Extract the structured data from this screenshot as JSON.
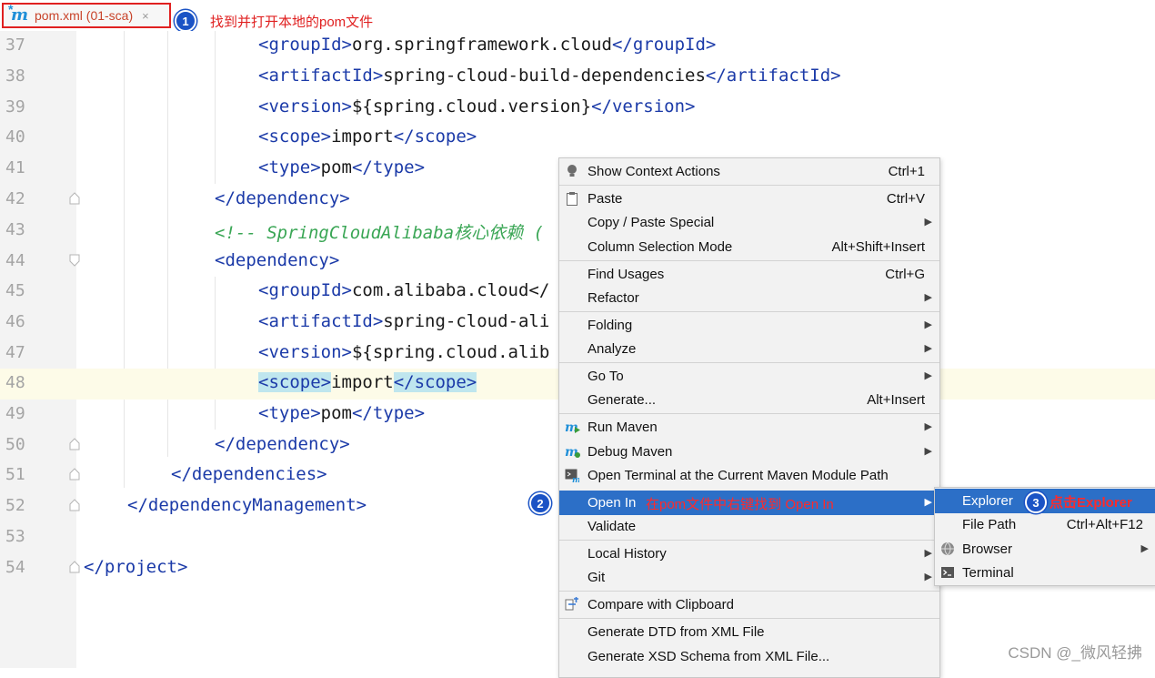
{
  "tab": {
    "title": "pom.xml (01-sca)",
    "close": "×"
  },
  "annotations": {
    "one": "1",
    "note1": "找到并打开本地的pom文件",
    "two": "2",
    "note2": "在pom文件中右键找到 Open In",
    "three": "3",
    "note3": "点击Explorer"
  },
  "editor": {
    "lines": [
      {
        "num": "37"
      },
      {
        "num": "38"
      },
      {
        "num": "39"
      },
      {
        "num": "40"
      },
      {
        "num": "41"
      },
      {
        "num": "42"
      },
      {
        "num": "43"
      },
      {
        "num": "44"
      },
      {
        "num": "45"
      },
      {
        "num": "46"
      },
      {
        "num": "47"
      },
      {
        "num": "48"
      },
      {
        "num": "49"
      },
      {
        "num": "50"
      },
      {
        "num": "51"
      },
      {
        "num": "52"
      },
      {
        "num": "53"
      },
      {
        "num": "54"
      }
    ],
    "code": {
      "l37": {
        "o": "<groupId>",
        "t": "org.springframework.cloud",
        "c": "</groupId>"
      },
      "l38": {
        "o": "<artifactId>",
        "t": "spring-cloud-build-dependencies",
        "c": "</artifactId>"
      },
      "l39": {
        "o": "<version>",
        "t": "${spring.cloud.version}",
        "c": "</version>"
      },
      "l40": {
        "o": "<scope>",
        "t": "import",
        "c": "</scope>"
      },
      "l41": {
        "o": "<type>",
        "t": "pom",
        "c": "</type>"
      },
      "l42": {
        "c": "</dependency>"
      },
      "l43": {
        "comment": "<!-- SpringCloudAlibaba核心依赖 ("
      },
      "l44": {
        "o": "<dependency>"
      },
      "l45": {
        "o": "<groupId>",
        "t": "com.alibaba.cloud</"
      },
      "l46": {
        "o": "<artifactId>",
        "t": "spring-cloud-ali"
      },
      "l47": {
        "o": "<version>",
        "t": "${spring.cloud.alib"
      },
      "l48": {
        "o": "<scope>",
        "t": "import",
        "c": "</scope>"
      },
      "l49": {
        "o": "<type>",
        "t": "pom",
        "c": "</type>"
      },
      "l50": {
        "c": "</dependency>"
      },
      "l51": {
        "c": "</dependencies>"
      },
      "l52": {
        "c": "</dependencyManagement>"
      },
      "l54": {
        "c": "</project>"
      }
    }
  },
  "context_menu": {
    "items": [
      {
        "label": "Show Context Actions",
        "shortcut": "Ctrl+1"
      },
      {
        "label": "Paste",
        "shortcut": "Ctrl+V"
      },
      {
        "label": "Copy / Paste Special"
      },
      {
        "label": "Column Selection Mode",
        "shortcut": "Alt+Shift+Insert"
      },
      {
        "label": "Find Usages",
        "shortcut": "Ctrl+G"
      },
      {
        "label": "Refactor"
      },
      {
        "label": "Folding"
      },
      {
        "label": "Analyze"
      },
      {
        "label": "Go To"
      },
      {
        "label": "Generate...",
        "shortcut": "Alt+Insert"
      },
      {
        "label": "Run Maven"
      },
      {
        "label": "Debug Maven"
      },
      {
        "label": "Open Terminal at the Current Maven Module Path"
      },
      {
        "label": "Open In"
      },
      {
        "label": "Validate"
      },
      {
        "label": "Local History"
      },
      {
        "label": "Git"
      },
      {
        "label": "Compare with Clipboard"
      },
      {
        "label": "Generate DTD from XML File"
      },
      {
        "label": "Generate XSD Schema from XML File..."
      }
    ],
    "arrow": "▶"
  },
  "submenu": {
    "items": [
      {
        "label": "Explorer"
      },
      {
        "label": "File Path",
        "shortcut": "Ctrl+Alt+F12"
      },
      {
        "label": "Browser"
      },
      {
        "label": "Terminal"
      }
    ]
  },
  "watermark": "CSDN @_微风轻拂",
  "colors": {
    "tag": "#1b3aa8",
    "comment": "#3aa655",
    "selection": "#2c6fc7",
    "annotation": "#e02020"
  }
}
